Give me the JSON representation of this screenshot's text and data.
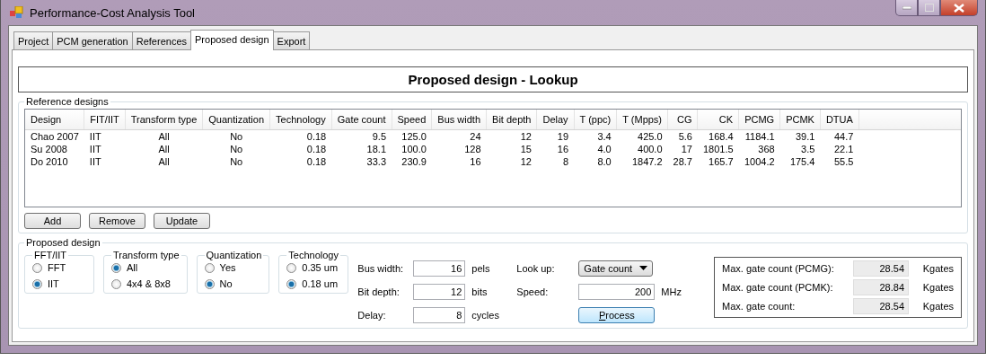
{
  "window": {
    "title": "Performance-Cost Analysis Tool"
  },
  "tabs": [
    {
      "label": "Project",
      "selected": false
    },
    {
      "label": "PCM generation",
      "selected": false
    },
    {
      "label": "References",
      "selected": false
    },
    {
      "label": "Proposed design",
      "selected": true
    },
    {
      "label": "Export",
      "selected": false
    }
  ],
  "heading": "Proposed design - Lookup",
  "reference_designs": {
    "title": "Reference designs",
    "columns": [
      "Design",
      "FIT/IIT",
      "Transform type",
      "Quantization",
      "Technology",
      "Gate count",
      "Speed",
      "Bus width",
      "Bit depth",
      "Delay",
      "T (ppc)",
      "T (Mpps)",
      "CG",
      "CK",
      "PCMG",
      "PCMK",
      "DTUA"
    ],
    "rows": [
      [
        "Chao 2007",
        "IIT",
        "All",
        "No",
        "0.18",
        "9.5",
        "125.0",
        "24",
        "12",
        "19",
        "3.4",
        "425.0",
        "5.6",
        "168.4",
        "1184.1",
        "39.1",
        "44.7"
      ],
      [
        "Su 2008",
        "IIT",
        "All",
        "No",
        "0.18",
        "18.1",
        "100.0",
        "128",
        "15",
        "16",
        "4.0",
        "400.0",
        "17",
        "1801.5",
        "368",
        "3.5",
        "22.1"
      ],
      [
        "Do 2010",
        "IIT",
        "All",
        "No",
        "0.18",
        "33.3",
        "230.9",
        "16",
        "12",
        "8",
        "8.0",
        "1847.2",
        "28.7",
        "165.7",
        "1004.2",
        "175.4",
        "55.5"
      ]
    ],
    "buttons": [
      "Add",
      "Remove",
      "Update"
    ]
  },
  "proposed_design": {
    "title": "Proposed design",
    "groups": [
      {
        "title": "FFT/IIT",
        "options": [
          {
            "label": "FFT",
            "selected": false
          },
          {
            "label": "IIT",
            "selected": true
          }
        ]
      },
      {
        "title": "Transform type",
        "options": [
          {
            "label": "All",
            "selected": true
          },
          {
            "label": "4x4 & 8x8",
            "selected": false
          }
        ]
      },
      {
        "title": "Quantization",
        "options": [
          {
            "label": "Yes",
            "selected": false
          },
          {
            "label": "No",
            "selected": true
          }
        ]
      },
      {
        "title": "Technology",
        "options": [
          {
            "label": "0.35 um",
            "selected": false
          },
          {
            "label": "0.18 um",
            "selected": true
          }
        ]
      }
    ],
    "fields": [
      {
        "label": "Bus width:",
        "value": "16",
        "unit": "pels"
      },
      {
        "label": "Bit depth:",
        "value": "12",
        "unit": "bits"
      },
      {
        "label": "Delay:",
        "value": "8",
        "unit": "cycles"
      }
    ],
    "lookup": {
      "label": "Look up:",
      "value": "Gate count"
    },
    "speed": {
      "label": "Speed:",
      "value": "200",
      "unit": "MHz"
    },
    "process_button": "Process",
    "results": [
      {
        "label": "Max. gate count (PCMG):",
        "value": "28.54",
        "unit": "Kgates"
      },
      {
        "label": "Max. gate count (PCMK):",
        "value": "28.84",
        "unit": "Kgates"
      },
      {
        "label": "Max. gate count:",
        "value": "28.54",
        "unit": "Kgates"
      }
    ]
  }
}
